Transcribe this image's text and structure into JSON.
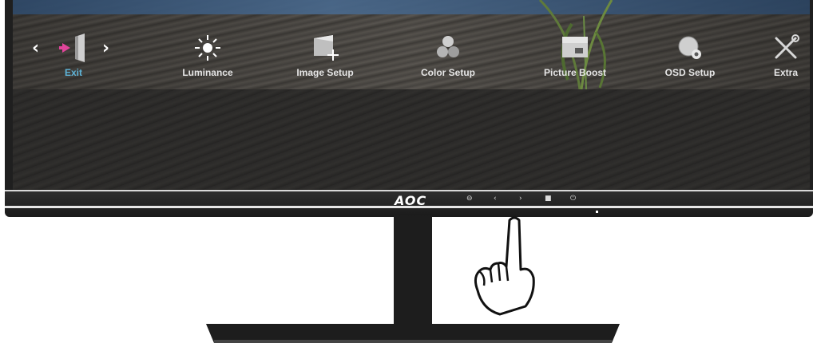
{
  "osd_menu": {
    "items": [
      {
        "label": "Exit",
        "icon": "exit-door-icon",
        "selected": true
      },
      {
        "label": "Luminance",
        "icon": "sun-icon",
        "selected": false
      },
      {
        "label": "Image Setup",
        "icon": "image-setup-icon",
        "selected": false
      },
      {
        "label": "Color Setup",
        "icon": "color-balls-icon",
        "selected": false
      },
      {
        "label": "Picture Boost",
        "icon": "picture-boost-icon",
        "selected": false
      },
      {
        "label": "OSD Setup",
        "icon": "osd-setup-icon",
        "selected": false
      },
      {
        "label": "Extra",
        "icon": "tools-icon",
        "selected": false
      }
    ],
    "nav_left": "‹",
    "nav_right": "›"
  },
  "bezel": {
    "brand": "AOC",
    "buttons": [
      "⊖",
      "‹",
      "›",
      "■",
      "⏻"
    ]
  },
  "colors": {
    "selected_label": "#5fb4d8",
    "label": "#e6e6e6",
    "exit_arrow": "#e0459a"
  }
}
